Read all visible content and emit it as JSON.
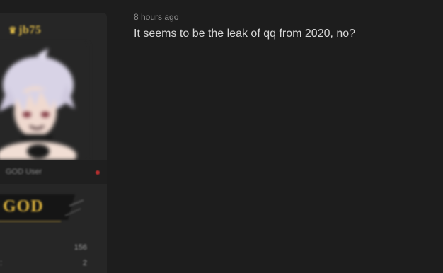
{
  "user": {
    "name": "jb75",
    "rank": "GOD User",
    "badge": "GOD",
    "stats": [
      "156",
      "2"
    ],
    "online_dot_color": "#b82f2f",
    "name_color": "#d7b446"
  },
  "post": {
    "time": "8 hours ago",
    "text": "It seems to be the leak of qq from 2020, no?"
  }
}
